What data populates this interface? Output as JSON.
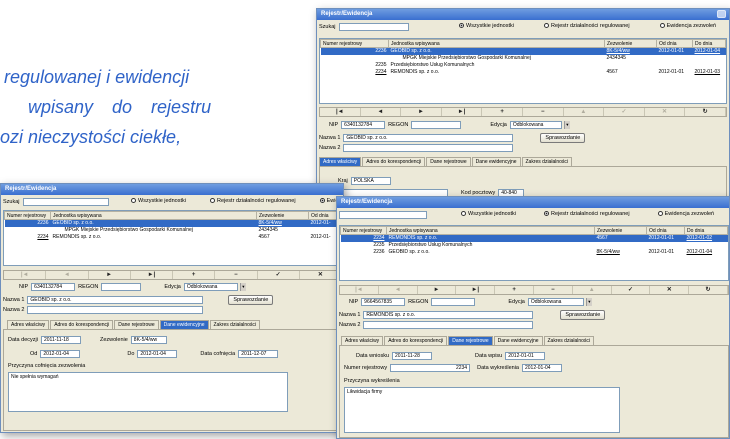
{
  "background_text": [
    "regulowanej i ewidencji",
    "wpisany do rejestru",
    "ozi nieczystości ciekłe,"
  ],
  "common": {
    "search_label": "Szukaj",
    "filters": [
      "Wszystkie jednostki",
      "Rejestr działalności regulowanej",
      "Ewidencja zezwoleń"
    ],
    "columns": [
      "Numer rejestrowy",
      "Jednostka wpisywana",
      "Zezwolenie",
      "Od dnia",
      "Do dnia"
    ],
    "nav_buttons": [
      "|◄",
      "◄",
      "►",
      "►|",
      "+",
      "−",
      "▲",
      "✓",
      "✕",
      "↻"
    ],
    "nip_label": "NIP",
    "regon_label": "REGON",
    "edycja_label": "Edycja",
    "edycja_value": "Odblokowana",
    "nazwa1_label": "Nazwa 1",
    "nazwa2_label": "Nazwa 2",
    "sprawozdanie_label": "Sprawozdanie",
    "tabs": [
      "Adres właściwy",
      "Adres do korespondencji",
      "Dane rejestrowe",
      "Dane ewidencyjne",
      "Zakres działalności"
    ]
  },
  "win_top": {
    "title": "Rejestr/Ewidencja",
    "rows": [
      {
        "nr": "2236",
        "name": "GEOBID sp. z o.o.",
        "zez": "8K-5/4/ww",
        "od": "2012-01-01",
        "do": "2012-01-04",
        "sel": true
      },
      {
        "nr": "",
        "name": "MPGK Miejskie Przedsiębiorstwo Gospodarki Komunalnej",
        "zez": "2434345",
        "od": "",
        "do": "",
        "sel": false
      },
      {
        "nr": "2235",
        "name": "Przedsiębiorstwo Usług Komunalnych",
        "zez": "",
        "od": "",
        "do": "",
        "sel": false
      },
      {
        "nr": "2234",
        "name": "REMONDIS sp. z o.o.",
        "zez": "4567",
        "od": "2012-01-01",
        "do": "2012-01-03",
        "sel": false
      }
    ],
    "nip": "6340132784",
    "nazwa1": "GEOBID sp. z o.o.",
    "kraj_label": "Kraj",
    "kraj_value": "POLSKA",
    "kod_label": "Kod pocztowy",
    "kod_value": "40-840"
  },
  "win_left": {
    "title": "Rejestr/Ewidencja",
    "rows": [
      {
        "nr": "2236",
        "name": "GEOBID sp. z o.o.",
        "zez": "8K-5/4/ww",
        "od": "2012-01-",
        "sel": true
      },
      {
        "nr": "",
        "name": "MPGK Miejskie Przedsiębiorstwo Gospodarki Komunalnej",
        "zez": "2434345",
        "od": "",
        "sel": false
      },
      {
        "nr": "2234",
        "name": "REMONDIS sp. z o.o.",
        "zez": "4567",
        "od": "2012-01-",
        "sel": false
      }
    ],
    "nip": "6340132784",
    "nazwa1": "GEOBID sp. z o.o.",
    "data_decyzji_label": "Data decyzji",
    "data_decyzji": "2011-11-18",
    "zezwolenie_label": "Zezwolenie",
    "zezwolenie": "8K-5/4/ww",
    "od_label": "Od",
    "od": "2012-01-04",
    "do_label": "Do",
    "do": "2012-01-04",
    "data_cofniecia_label": "Data cofnięcia",
    "data_cofniecia": "2011-12-07",
    "przyczyna_label": "Przyczyna cofnięcia zezwolenia",
    "przyczyna": "Nie spełnia wymagań"
  },
  "win_right": {
    "title": "Rejestr/Ewidencja",
    "rows": [
      {
        "nr": "2234",
        "name": "REMONDIS sp. z o.o.",
        "zez": "4567",
        "od": "2012-01-01",
        "do": "2012-01-02",
        "sel": true
      },
      {
        "nr": "2235",
        "name": "Przedsiębiorstwo Usług Komunalnych",
        "zez": "",
        "od": "",
        "do": "",
        "sel": false
      },
      {
        "nr": "2236",
        "name": "GEOBID sp. z o.o.",
        "zez": "8K-5/4/ww",
        "od": "2012-01-01",
        "do": "2012-01-04",
        "sel": false
      }
    ],
    "nip": "9664567835",
    "edycja_value": "Odblokowana",
    "nazwa1": "REMONDIS sp. z o.o.",
    "data_wniosku_label": "Data wniosku",
    "data_wniosku": "2011-11-28",
    "data_wpisu_label": "Data wpisu",
    "data_wpisu": "2012-01-01",
    "numer_label": "Numer rejestrowy",
    "numer": "2234",
    "data_wykreslenia_label": "Data wykreślenia",
    "data_wykreslenia": "2012-01-04",
    "przyczyna_label": "Przyczyna wykreślenia",
    "przyczyna": "Likwidacja firmy"
  }
}
